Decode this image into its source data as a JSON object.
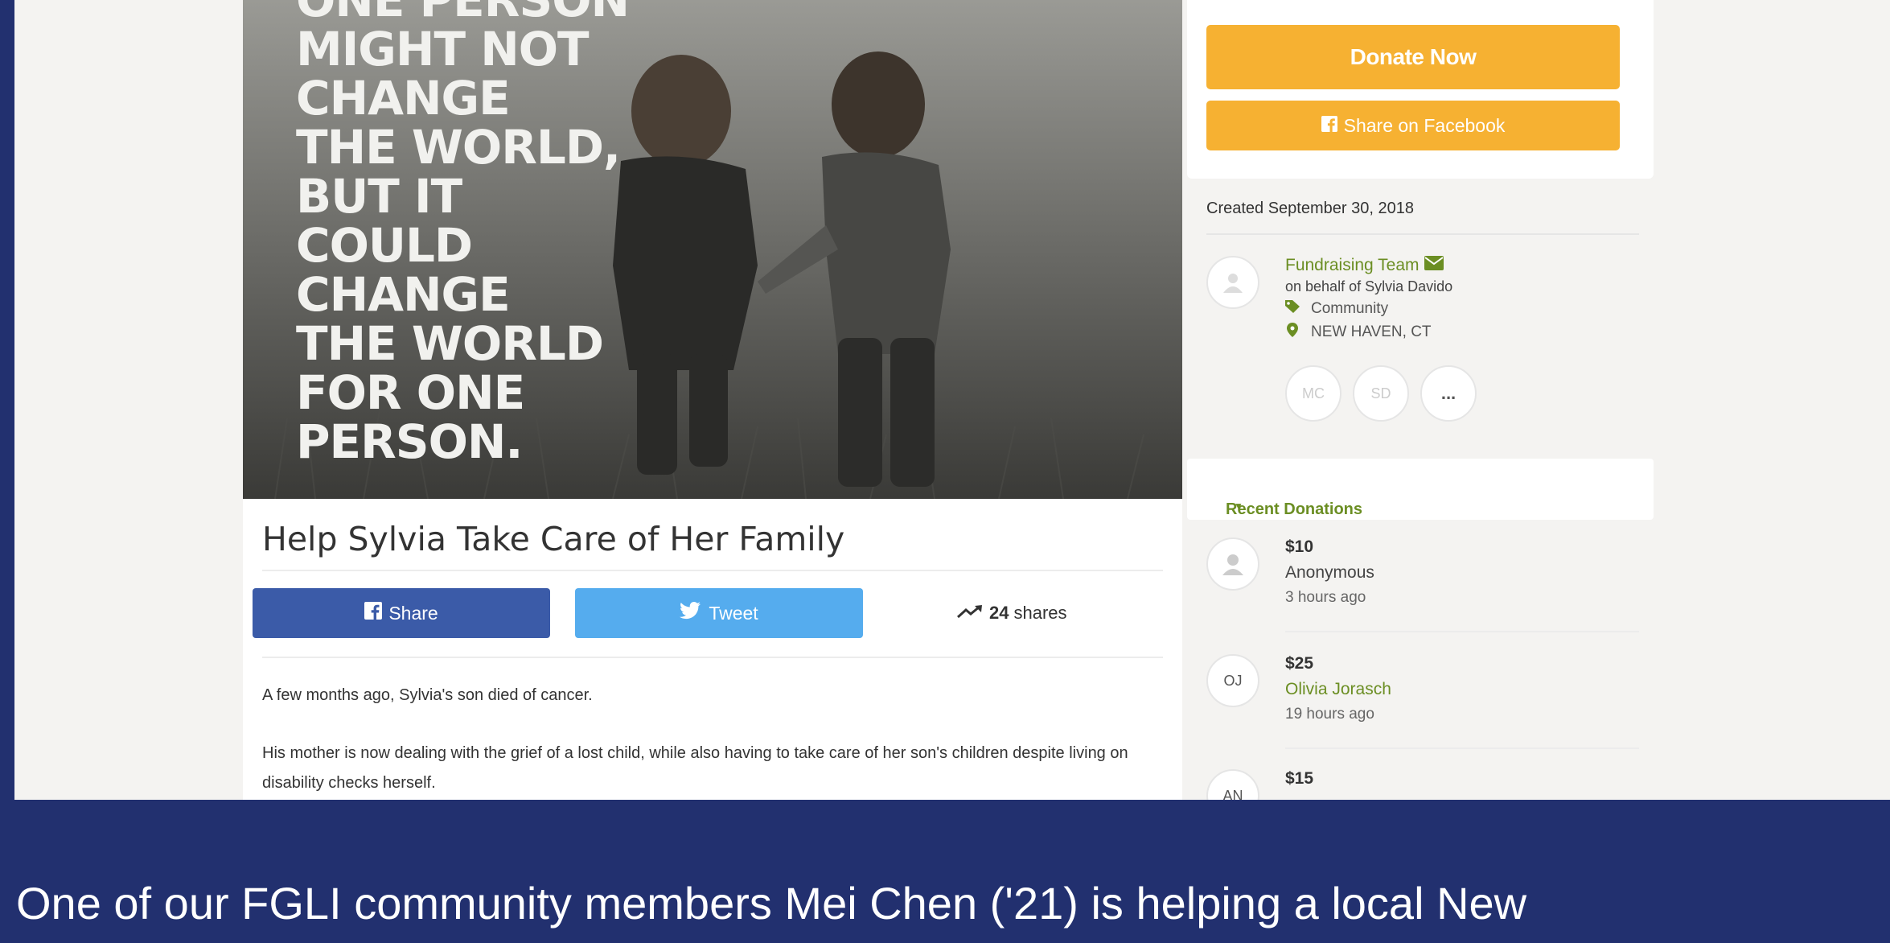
{
  "hero": {
    "quote_lines": [
      "ONE PERSON",
      "MIGHT NOT",
      "CHANGE",
      "THE WORLD,",
      "BUT IT",
      "COULD",
      "CHANGE",
      "THE WORLD",
      "FOR ONE",
      "PERSON."
    ]
  },
  "campaign": {
    "title": "Help Sylvia Take Care of Her Family",
    "share_label": "Share",
    "tweet_label": "Tweet",
    "shares_count": "24",
    "shares_label": "shares",
    "story": [
      "A few months ago, Sylvia's son died of cancer.",
      "His mother is now dealing with the grief of a lost child, while also having to take care of her son's children despite living on disability checks herself."
    ]
  },
  "sidebar": {
    "donate_label": "Donate Now",
    "facebook_label": "Share on Facebook",
    "created": "Created September 30, 2018",
    "organizer": {
      "team": "Fundraising Team",
      "behalf": "on behalf of Sylvia Davido",
      "category": "Community",
      "location": "NEW HAVEN, CT"
    },
    "team_members": [
      "MC",
      "SD",
      "..."
    ],
    "recent_label": "Recent Donations"
  },
  "donations": [
    {
      "initials": "",
      "amount": "$10",
      "name": "Anonymous",
      "time": "3 hours ago",
      "linked": false
    },
    {
      "initials": "OJ",
      "amount": "$25",
      "name": "Olivia Jorasch",
      "time": "19 hours ago",
      "linked": true
    },
    {
      "initials": "AN",
      "amount": "$15",
      "name": "",
      "time": "",
      "linked": false
    }
  ],
  "caption": "One of our FGLI community members Mei Chen ('21) is helping a local New",
  "colors": {
    "slide_bg": "#22306f",
    "donate": "#f6b132",
    "facebook": "#3b5ba8",
    "twitter": "#55acee",
    "accent_green": "#6b8e23"
  }
}
